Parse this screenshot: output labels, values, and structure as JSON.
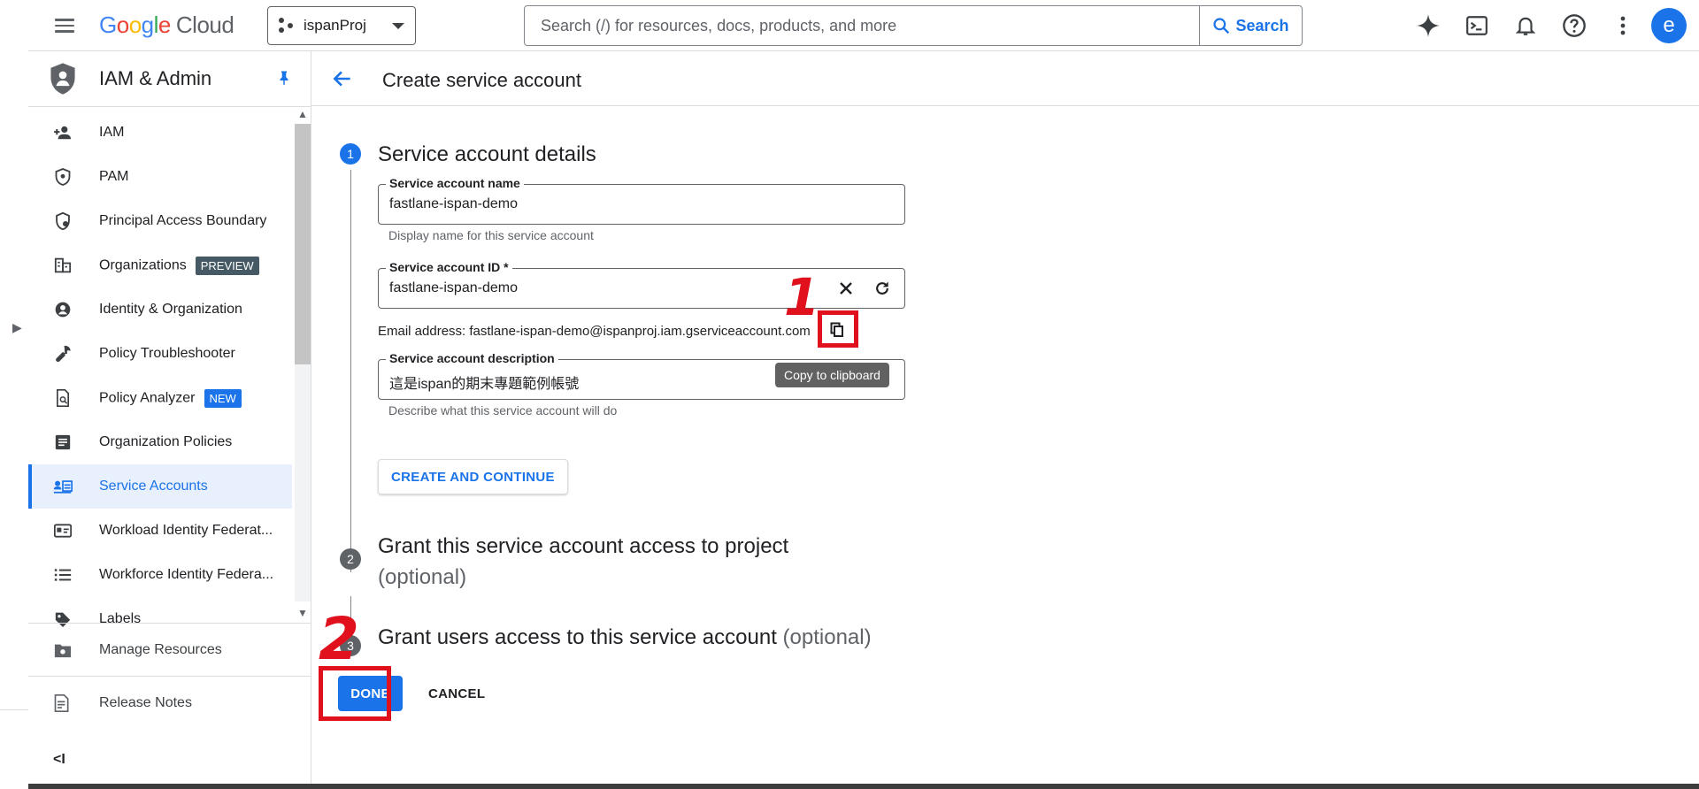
{
  "header": {
    "logo_google": "Google",
    "logo_cloud": "Cloud",
    "project": "ispanProj",
    "search_placeholder": "Search (/) for resources, docs, products, and more",
    "search_button": "Search",
    "avatar_initial": "e",
    "icons": [
      "menu-icon",
      "gemini-spark-icon",
      "cloud-shell-icon",
      "notifications-icon",
      "help-icon",
      "more-vert-icon"
    ]
  },
  "sidebar": {
    "title": "IAM & Admin",
    "items": [
      {
        "label": "IAM",
        "icon": "add-person-icon"
      },
      {
        "label": "PAM",
        "icon": "shield-lock-icon"
      },
      {
        "label": "Principal Access Boundary",
        "icon": "boundary-shield-icon"
      },
      {
        "label": "Organizations",
        "badge": "PREVIEW",
        "icon": "organization-icon"
      },
      {
        "label": "Identity & Organization",
        "icon": "account-circle-icon"
      },
      {
        "label": "Policy Troubleshooter",
        "icon": "wrench-icon"
      },
      {
        "label": "Policy Analyzer",
        "badge": "NEW",
        "icon": "policy-analyzer-icon"
      },
      {
        "label": "Organization Policies",
        "icon": "document-icon"
      },
      {
        "label": "Service Accounts",
        "icon": "service-account-icon",
        "active": true
      },
      {
        "label": "Workload Identity Federat...",
        "icon": "id-card-icon"
      },
      {
        "label": "Workforce Identity Federa...",
        "icon": "list-icon"
      },
      {
        "label": "Labels",
        "icon": "label-icon"
      }
    ],
    "footer": [
      {
        "label": "Manage Resources",
        "icon": "manage-resources-icon"
      },
      {
        "label": "Release Notes",
        "icon": "release-notes-icon"
      }
    ],
    "collapse_label": "<I"
  },
  "main": {
    "page_title": "Create service account",
    "step1": {
      "number": "1",
      "title": "Service account details",
      "name_label": "Service account name",
      "name_value": "fastlane-ispan-demo",
      "name_hint": "Display name for this service account",
      "id_label": "Service account ID *",
      "id_value": "fastlane-ispan-demo",
      "email_text": "Email address: fastlane-ispan-demo@ispanproj.iam.gserviceaccount.com",
      "copy_tooltip": "Copy to clipboard",
      "desc_label": "Service account description",
      "desc_value": "這是ispan的期末專題範例帳號",
      "desc_hint": "Describe what this service account will do",
      "create_button": "CREATE AND CONTINUE"
    },
    "step2": {
      "number": "2",
      "title": "Grant this service account access to project",
      "optional": "(optional)"
    },
    "step3": {
      "number": "3",
      "title": "Grant users access to this service account",
      "optional": "(optional)"
    },
    "done_button": "DONE",
    "cancel_button": "CANCEL"
  },
  "annotations": {
    "marker1": "1",
    "marker2": "2",
    "color": "#e0101c"
  },
  "colors": {
    "accent": "#1a73e8",
    "active_bg": "#e8f0fe",
    "annotation": "#e0101c"
  }
}
